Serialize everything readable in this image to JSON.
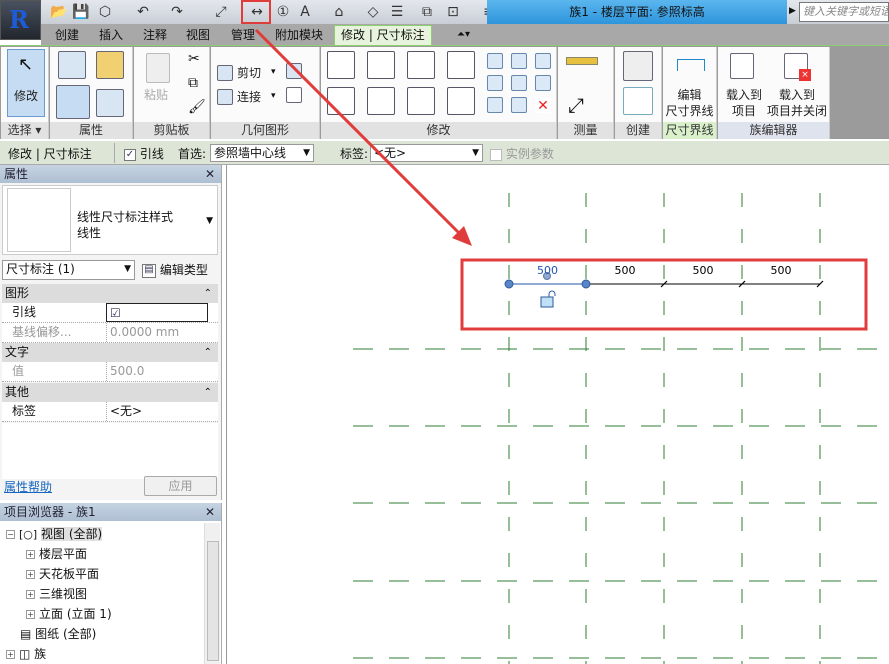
{
  "app": {
    "logo": "R",
    "title": "族1 - 楼层平面: 参照标高",
    "search_placeholder": "键入关键字或短语"
  },
  "quick_access": [
    "open-icon",
    "save-icon",
    "sync-icon",
    "undo-icon",
    "redo-icon",
    "aligned-dimension-icon",
    "measure-icon",
    "tag-icon",
    "text-icon",
    "3d-view-icon",
    "section-icon",
    "thin-lines-icon",
    "close-hidden-icon",
    "switch-windows-icon",
    "customize-icon"
  ],
  "tabs": [
    {
      "label": "创建"
    },
    {
      "label": "插入"
    },
    {
      "label": "注释"
    },
    {
      "label": "视图"
    },
    {
      "label": "管理"
    },
    {
      "label": "附加模块"
    },
    {
      "label": "修改 | 尺寸标注",
      "active": true
    }
  ],
  "ribbon": {
    "panels": [
      "选择",
      "属性",
      "剪贴板",
      "几何图形",
      "修改",
      "测量",
      "创建",
      "尺寸界线",
      "族编辑器"
    ],
    "modify_label": "修改",
    "paste_label": "粘贴",
    "cut_label": "剪切",
    "join_label": "连接",
    "edit_witness_label": [
      "编辑",
      "尺寸界线"
    ],
    "load_project_label": [
      "载入到",
      "项目"
    ],
    "load_close_label": [
      "载入到",
      "项目并关闭"
    ]
  },
  "options_bar": {
    "context": "修改 | 尺寸标注",
    "leader_label": "引线",
    "leader_checked": true,
    "prefer_label": "首选:",
    "prefer_value": "参照墙中心线",
    "label_label": "标签:",
    "label_value": "<无>",
    "instance_param_label": "实例参数",
    "instance_param_checked": false
  },
  "properties": {
    "title": "属性",
    "type_name": "线性尺寸标注样式",
    "type_sub": "线性",
    "selector": "尺寸标注 (1)",
    "edit_type": "编辑类型",
    "groups": [
      {
        "name": "图形",
        "rows": [
          {
            "k": "引线",
            "v": "☑"
          },
          {
            "k": "基线偏移...",
            "v": "0.0000 mm"
          }
        ]
      },
      {
        "name": "文字",
        "rows": [
          {
            "k": "值",
            "v": "500.0"
          }
        ]
      },
      {
        "name": "其他",
        "rows": [
          {
            "k": "标签",
            "v": "<无>"
          }
        ]
      }
    ],
    "help": "属性帮助",
    "apply": "应用"
  },
  "browser": {
    "title": "项目浏览器 - 族1",
    "items": [
      "视图 (全部)",
      "楼层平面",
      "天花板平面",
      "三维视图",
      "立面 (立面 1)",
      "图纸 (全部)",
      "族"
    ]
  },
  "drawing": {
    "dimensions": [
      "500",
      "500",
      "500",
      "500"
    ],
    "highlight_color": "#e03c3c",
    "grid_color": "#2e7d32",
    "selected_color": "#2255aa"
  }
}
